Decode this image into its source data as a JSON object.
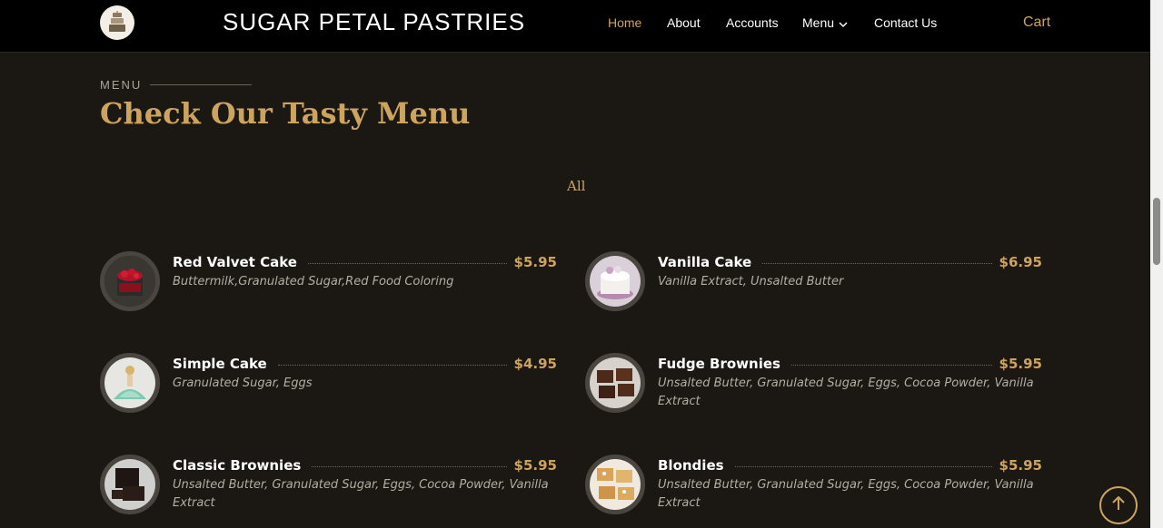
{
  "header": {
    "brand": "SUGAR PETAL PASTRIES",
    "nav": [
      "Home",
      "About",
      "Accounts",
      "Menu",
      "Contact Us"
    ],
    "cart": "Cart"
  },
  "section": {
    "eyebrow": "MENU",
    "title": "Check Our Tasty Menu",
    "filter": "All"
  },
  "items": [
    {
      "name": "Red Valvet Cake",
      "price": "$5.95",
      "desc": "Buttermilk,Granulated Sugar,Red Food Coloring"
    },
    {
      "name": "Vanilla Cake",
      "price": "$6.95",
      "desc": "Vanilla Extract, Unsalted Butter"
    },
    {
      "name": "Simple Cake",
      "price": "$4.95",
      "desc": "Granulated Sugar, Eggs"
    },
    {
      "name": "Fudge Brownies",
      "price": "$5.95",
      "desc": "Unsalted Butter, Granulated Sugar, Eggs, Cocoa Powder, Vanilla Extract"
    },
    {
      "name": "Classic Brownies",
      "price": "$5.95",
      "desc": "Unsalted Butter, Granulated Sugar, Eggs, Cocoa Powder, Vanilla Extract"
    },
    {
      "name": "Blondies",
      "price": "$5.95",
      "desc": "Unsalted Butter, Granulated Sugar, Eggs, Cocoa Powder, Vanilla Extract"
    }
  ],
  "colors": {
    "accent": "#cda45e",
    "background": "#1b1814",
    "header": "#000000"
  }
}
